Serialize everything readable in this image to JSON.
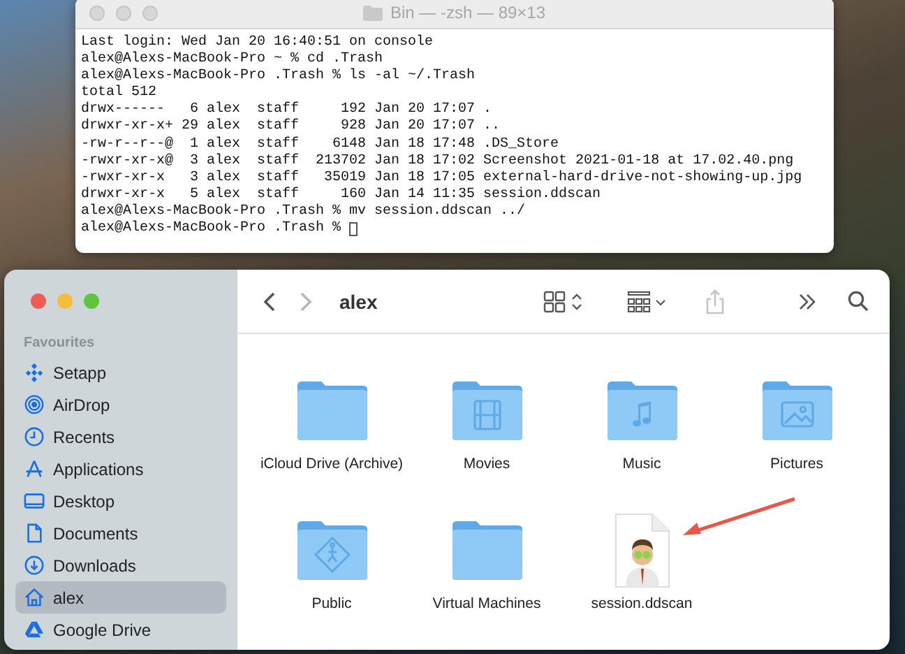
{
  "terminal": {
    "title": "Bin — -zsh — 89×13",
    "lines": [
      "Last login: Wed Jan 20 16:40:51 on console",
      "alex@Alexs-MacBook-Pro ~ % cd .Trash",
      "alex@Alexs-MacBook-Pro .Trash % ls -al ~/.Trash",
      "total 512",
      "drwx------   6 alex  staff     192 Jan 20 17:07 .",
      "drwxr-xr-x+ 29 alex  staff     928 Jan 20 17:07 ..",
      "-rw-r--r--@  1 alex  staff    6148 Jan 18 17:48 .DS_Store",
      "-rwxr-xr-x@  3 alex  staff  213702 Jan 18 17:02 Screenshot 2021-01-18 at 17.02.40.png",
      "-rwxr-xr-x   3 alex  staff   35019 Jan 18 17:05 external-hard-drive-not-showing-up.jpg",
      "drwxr-xr-x   5 alex  staff     160 Jan 14 11:35 session.ddscan",
      "alex@Alexs-MacBook-Pro .Trash % mv session.ddscan ../",
      "alex@Alexs-MacBook-Pro .Trash % "
    ]
  },
  "finder": {
    "title": "alex",
    "sidebar": {
      "heading": "Favourites",
      "items": [
        {
          "label": "Setapp",
          "selected": false
        },
        {
          "label": "AirDrop",
          "selected": false
        },
        {
          "label": "Recents",
          "selected": false
        },
        {
          "label": "Applications",
          "selected": false
        },
        {
          "label": "Desktop",
          "selected": false
        },
        {
          "label": "Documents",
          "selected": false
        },
        {
          "label": "Downloads",
          "selected": false
        },
        {
          "label": "alex",
          "selected": true
        },
        {
          "label": "Google Drive",
          "selected": false
        }
      ]
    },
    "items": [
      {
        "kind": "folder",
        "label": "iCloud Drive (Archive)"
      },
      {
        "kind": "folder",
        "label": "Movies"
      },
      {
        "kind": "folder",
        "label": "Music"
      },
      {
        "kind": "folder",
        "label": "Pictures"
      },
      {
        "kind": "folder",
        "label": "Public"
      },
      {
        "kind": "folder",
        "label": "Virtual Machines"
      },
      {
        "kind": "file",
        "label": "session.ddscan"
      }
    ]
  }
}
